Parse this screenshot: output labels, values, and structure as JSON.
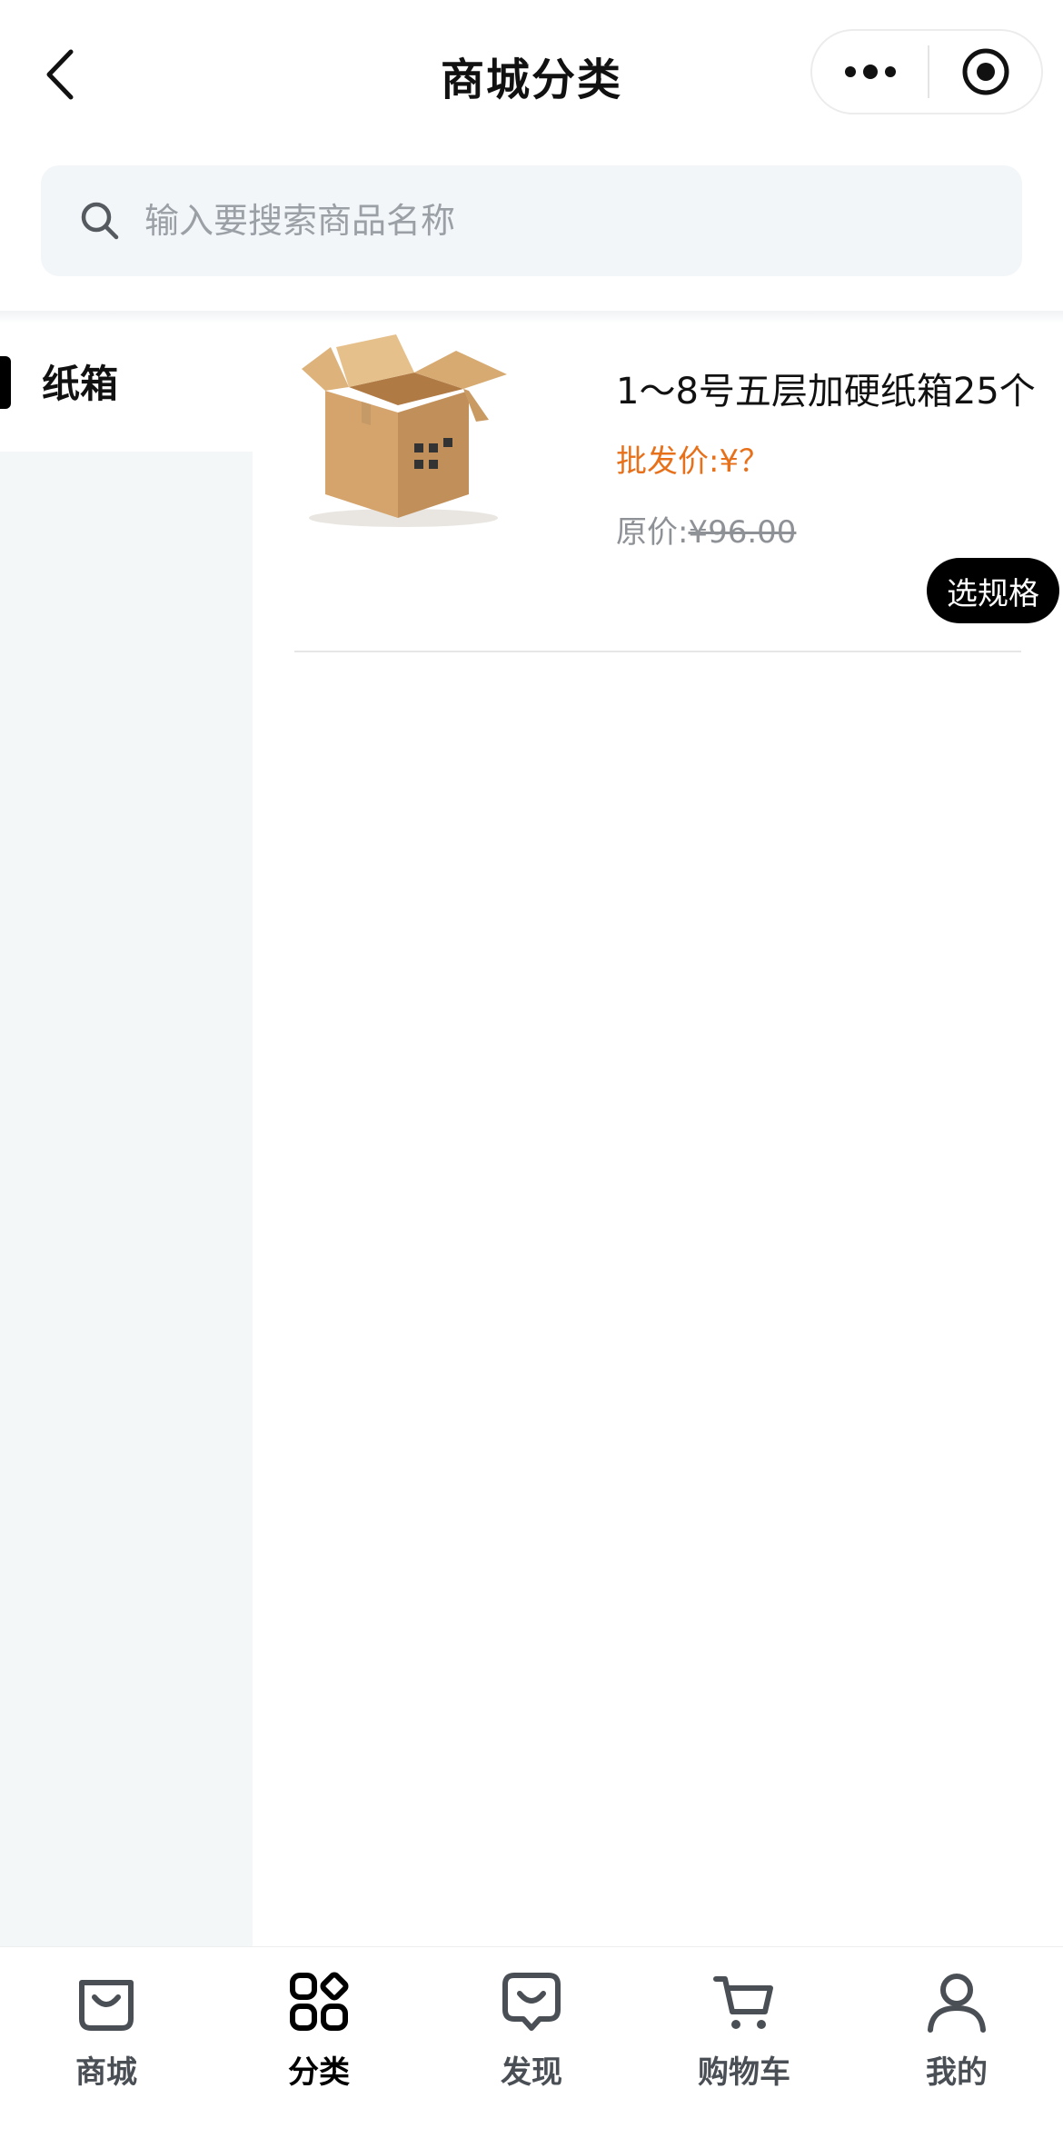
{
  "header": {
    "title": "商城分类"
  },
  "search": {
    "placeholder": "输入要搜索商品名称"
  },
  "sidebar": {
    "items": [
      {
        "label": "纸箱",
        "active": true
      }
    ]
  },
  "products": [
    {
      "name": "1～8号五层加硬纸箱25个",
      "wholesale_label": "批发价:",
      "wholesale_price": "¥？",
      "original_label": "原价:",
      "original_price": "¥96.00",
      "spec_button": "选规格"
    }
  ],
  "tabbar": {
    "items": [
      {
        "label": "商城",
        "icon": "bag-icon",
        "active": false
      },
      {
        "label": "分类",
        "icon": "category-grid-icon",
        "active": true
      },
      {
        "label": "发现",
        "icon": "discover-chat-icon",
        "active": false
      },
      {
        "label": "购物车",
        "icon": "cart-icon",
        "active": false
      },
      {
        "label": "我的",
        "icon": "user-icon",
        "active": false
      }
    ]
  },
  "colors": {
    "accent_price": "#e7711b",
    "sidebar_bg": "#f4f7f8",
    "search_bg": "#f3f6f8",
    "button_bg": "#000000"
  }
}
